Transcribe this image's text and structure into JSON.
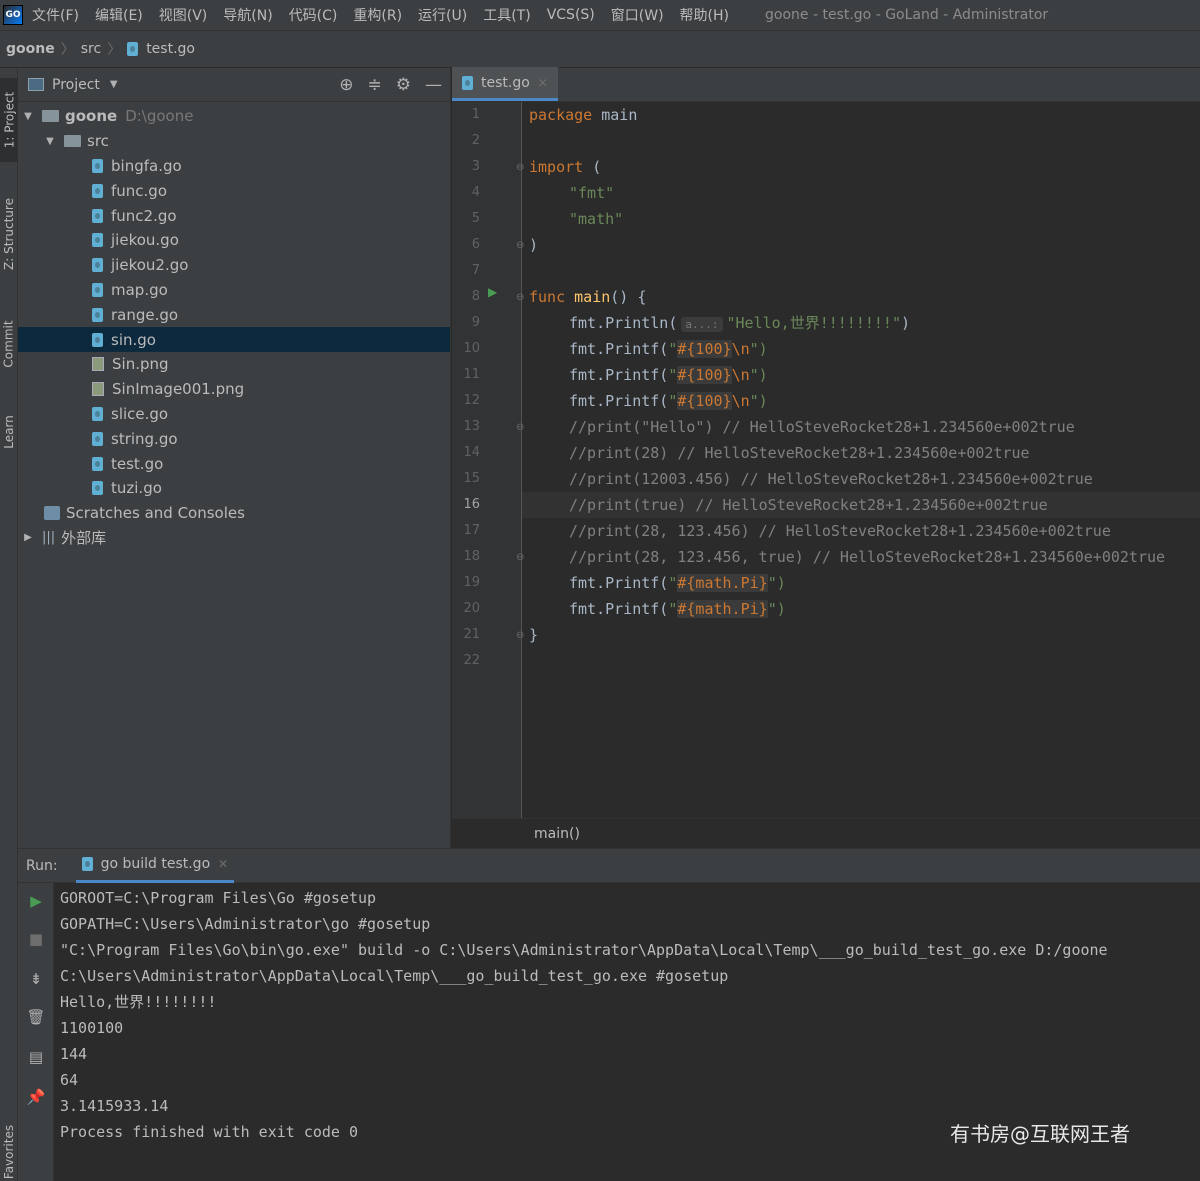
{
  "menubar": {
    "items": [
      "文件(F)",
      "编辑(E)",
      "视图(V)",
      "导航(N)",
      "代码(C)",
      "重构(R)",
      "运行(U)",
      "工具(T)",
      "VCS(S)",
      "窗口(W)",
      "帮助(H)"
    ],
    "window_title": "goone - test.go - GoLand - Administrator"
  },
  "navbar": {
    "crumbs": [
      "goone",
      "src",
      "test.go"
    ]
  },
  "left_strip": {
    "tabs": [
      "1: Project",
      "Z: Structure",
      "Commit",
      "Learn",
      "Favorites"
    ]
  },
  "project": {
    "title": "Project",
    "root_name": "goone",
    "root_path": "D:\\goone",
    "src_folder": "src",
    "files": [
      "bingfa.go",
      "func.go",
      "func2.go",
      "jiekou.go",
      "jiekou2.go",
      "map.go",
      "range.go",
      "sin.go",
      "Sin.png",
      "SinImage001.png",
      "slice.go",
      "string.go",
      "test.go",
      "tuzi.go"
    ],
    "selected_file": "sin.go",
    "scratches": "Scratches and Consoles",
    "external": "外部库"
  },
  "editor": {
    "tab_label": "test.go",
    "current_line": 16,
    "line_numbers": [
      "1",
      "2",
      "3",
      "4",
      "5",
      "6",
      "7",
      "8",
      "9",
      "10",
      "11",
      "12",
      "13",
      "14",
      "15",
      "16",
      "17",
      "18",
      "19",
      "20",
      "21",
      "22"
    ],
    "breadcrumb": "main()",
    "lines": {
      "l1_kw": "package",
      "l1_name": "main",
      "l3_kw": "import",
      "l3_paren": "(",
      "l4": "\"fmt\"",
      "l5": "\"math\"",
      "l6": ")",
      "l8_kw": "func",
      "l8_fn": "main",
      "l8_rest": "() {",
      "l9_call": "fmt.Println(",
      "l9_hint": "a...:",
      "l9_str": "\"Hello,世界!!!!!!!!\"",
      "l9_close": ")",
      "printf_call": "fmt.Printf(",
      "printf_q": "\"",
      "printf_ph": "#{100}",
      "printf_esc": "\\n",
      "printf_close": "\")",
      "l13": "//print(\"Hello\") // HelloSteveRocket28+1.234560e+002true",
      "l14": "//print(28) // HelloSteveRocket28+1.234560e+002true",
      "l15": "//print(12003.456) // HelloSteveRocket28+1.234560e+002true",
      "l16": "//print(true) // HelloSteveRocket28+1.234560e+002true",
      "l17": "//print(28, 123.456) // HelloSteveRocket28+1.234560e+002true",
      "l18": "//print(28, 123.456, true) // HelloSteveRocket28+1.234560e+002true",
      "pi_ph": "#{math.Pi}",
      "l21": "}"
    }
  },
  "run": {
    "label": "Run:",
    "tab_label": "go build test.go",
    "output": [
      "GOROOT=C:\\Program Files\\Go #gosetup",
      "GOPATH=C:\\Users\\Administrator\\go #gosetup",
      "\"C:\\Program Files\\Go\\bin\\go.exe\" build -o C:\\Users\\Administrator\\AppData\\Local\\Temp\\___go_build_test_go.exe D:/goone",
      "C:\\Users\\Administrator\\AppData\\Local\\Temp\\___go_build_test_go.exe #gosetup",
      "Hello,世界!!!!!!!!",
      "1100100",
      "144",
      "64",
      "3.1415933.14",
      "Process finished with exit code 0"
    ]
  },
  "watermark": "有书房@互联网王者",
  "colors": {
    "background": "#2b2b2b",
    "panel": "#3c3f41",
    "keyword": "#cc7832",
    "string": "#6a8759",
    "comment": "#808080",
    "function": "#ffc66d",
    "selection": "#0d293e",
    "accent": "#4a88c7"
  }
}
